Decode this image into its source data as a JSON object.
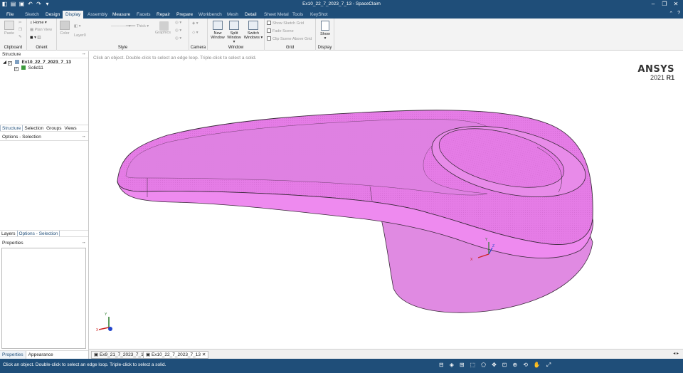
{
  "window": {
    "title": "Ex10_22_7_2023_7_13 - SpaceClaim",
    "controls": [
      "minimize",
      "restore",
      "close"
    ]
  },
  "ribbon": {
    "tabs": [
      {
        "label": "File",
        "state": "enabled"
      },
      {
        "label": "Sketch",
        "state": "disabled"
      },
      {
        "label": "Design",
        "state": "enabled"
      },
      {
        "label": "Display",
        "state": "active"
      },
      {
        "label": "Assembly",
        "state": "disabled"
      },
      {
        "label": "Measure",
        "state": "enabled"
      },
      {
        "label": "Facets",
        "state": "disabled"
      },
      {
        "label": "Repair",
        "state": "enabled"
      },
      {
        "label": "Prepare",
        "state": "enabled"
      },
      {
        "label": "Workbench",
        "state": "disabled"
      },
      {
        "label": "Mesh",
        "state": "disabled"
      },
      {
        "label": "Detail",
        "state": "enabled"
      },
      {
        "label": "Sheet Metal",
        "state": "disabled"
      },
      {
        "label": "Tools",
        "state": "disabled"
      },
      {
        "label": "KeyShot",
        "state": "disabled"
      }
    ],
    "groups": {
      "clipboard": {
        "label": "Clipboard",
        "paste": "Paste"
      },
      "orient": {
        "label": "Orient",
        "home": "Home",
        "plan_view": "Plan View"
      },
      "style": {
        "label": "Style",
        "color": "Color",
        "layer": "Layer0",
        "thick": "Thick"
      },
      "graphics": {
        "label": "Graphics"
      },
      "camera": {
        "label": "Camera"
      },
      "window": {
        "label": "Window",
        "new_window": [
          "New",
          "Window"
        ],
        "split": [
          "Split",
          "Window"
        ],
        "switch_windows": [
          "Switch",
          "Windows"
        ]
      },
      "grid": {
        "label": "Grid",
        "options": [
          "Show Sketch Grid",
          "Fade Scene",
          "Clip Scene Above Grid"
        ]
      },
      "display": {
        "label": "Display",
        "show": "Show"
      }
    }
  },
  "structure": {
    "title": "Structure",
    "pin": "⭬",
    "root": "Ex10_22_7_2023_7_13",
    "child": "Solid11",
    "tabs": [
      "Structure",
      "Selection",
      "Groups",
      "Views"
    ]
  },
  "options_panel": {
    "title": "Options - Selection"
  },
  "layers_tabs": [
    "Layers",
    "Options - Selection"
  ],
  "properties": {
    "title": "Properties",
    "tabs": [
      "Properties",
      "Appearance"
    ]
  },
  "viewport": {
    "hint": "Click an object. Double-click to select an edge loop. Triple-click to select a solid.",
    "brand": "ANSYS",
    "brand_year": "2021",
    "brand_release": "R1",
    "axes_labels": {
      "x": "X",
      "y": "Y",
      "z": "Z"
    },
    "model_color": "#e77ce7"
  },
  "doc_tabs": [
    {
      "label": "Ex9_21_7_2023_7_13",
      "active": false
    },
    {
      "label": "Ex10_22_7_2023_7_13",
      "active": true
    }
  ],
  "status": {
    "message": "Click an object. Double-click to select an edge loop. Triple-click to select a solid."
  }
}
